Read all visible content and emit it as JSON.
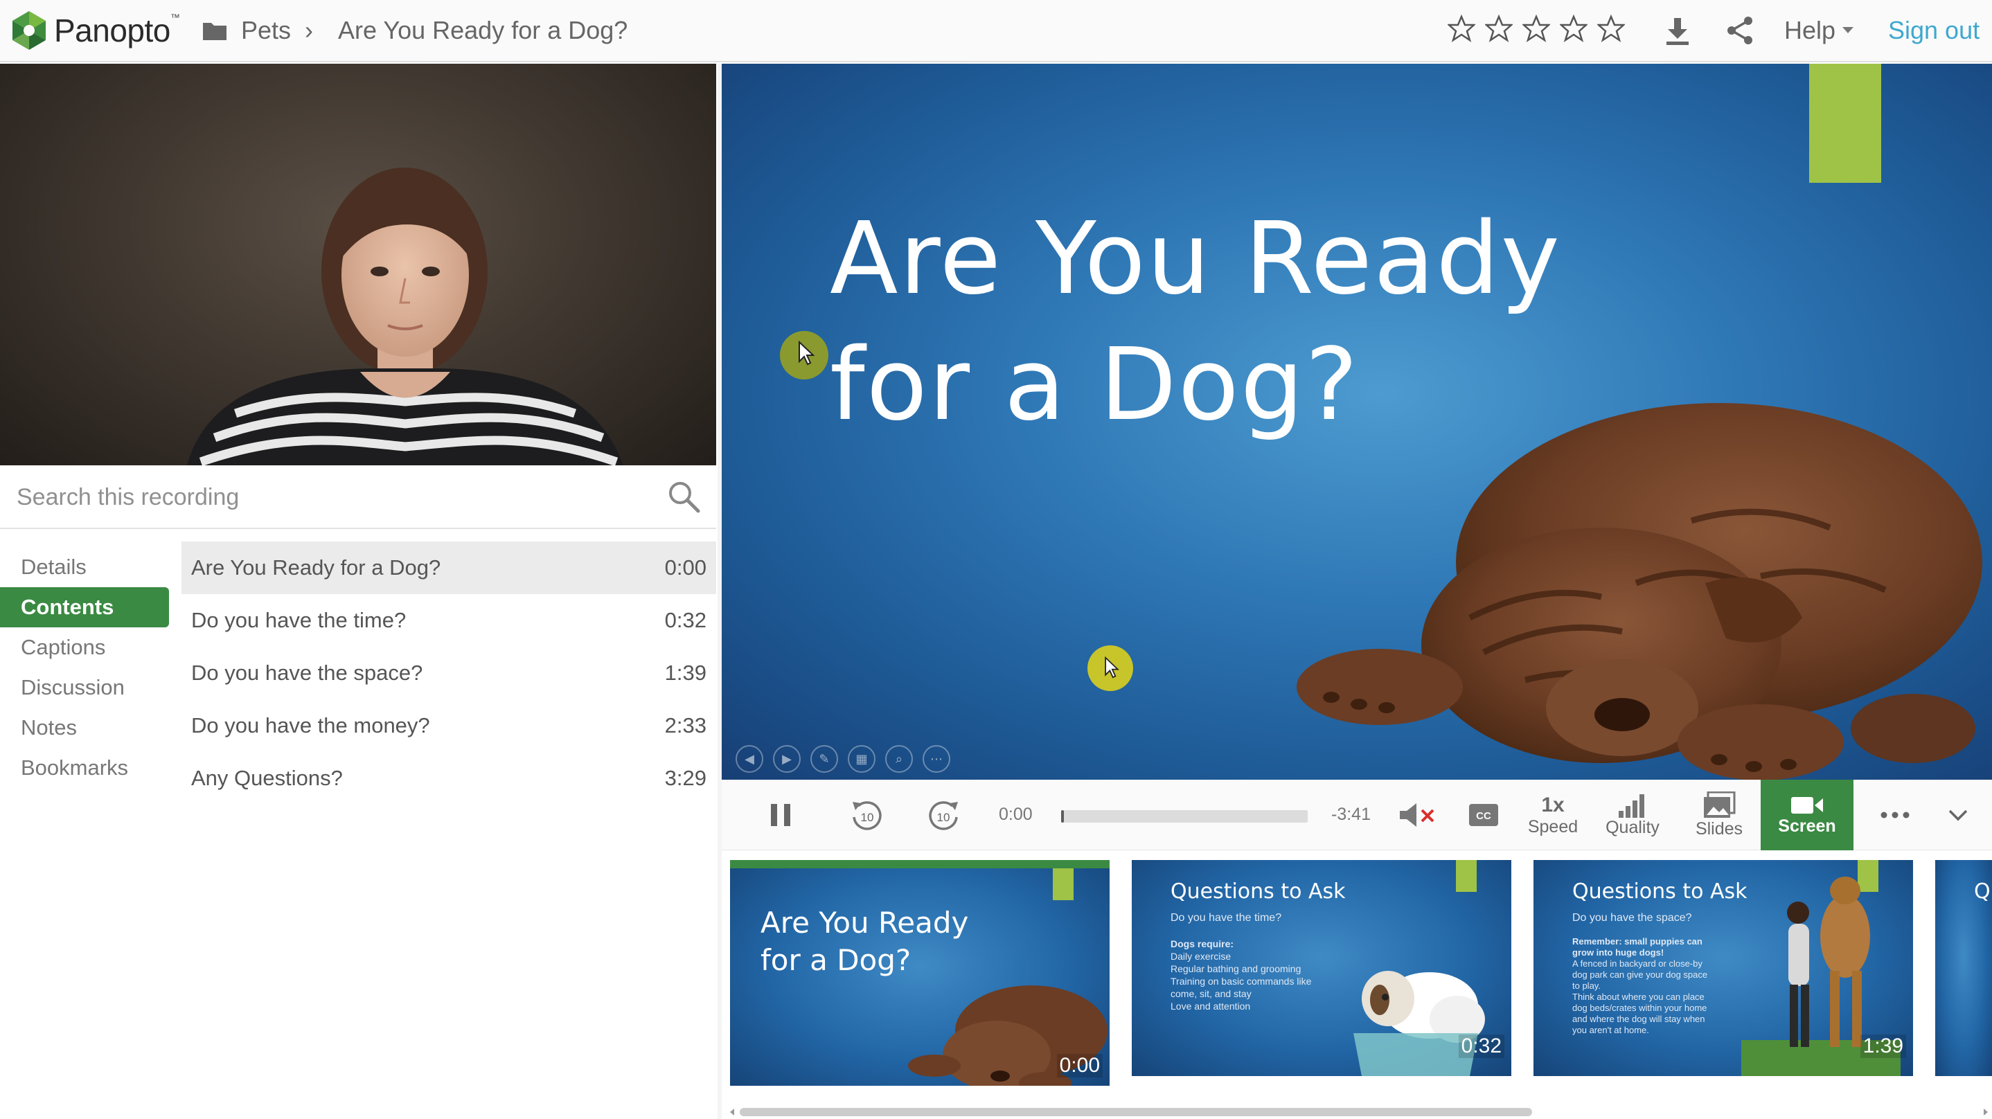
{
  "header": {
    "brand": "Panopto",
    "brand_tm": "™",
    "breadcrumb_folder": "Pets",
    "breadcrumb_separator": "›",
    "breadcrumb_title": "Are You Ready for a Dog?",
    "rating_stars": 5,
    "help_label": "Help",
    "signout_label": "Sign out"
  },
  "search": {
    "placeholder": "Search this recording"
  },
  "tabs": [
    {
      "label": "Details",
      "active": false
    },
    {
      "label": "Contents",
      "active": true
    },
    {
      "label": "Captions",
      "active": false
    },
    {
      "label": "Discussion",
      "active": false
    },
    {
      "label": "Notes",
      "active": false
    },
    {
      "label": "Bookmarks",
      "active": false
    }
  ],
  "contents": [
    {
      "title": "Are You Ready for a Dog?",
      "time": "0:00"
    },
    {
      "title": "Do you have the time?",
      "time": "0:32"
    },
    {
      "title": "Do you have the space?",
      "time": "1:39"
    },
    {
      "title": "Do you have the money?",
      "time": "2:33"
    },
    {
      "title": "Any Questions?",
      "time": "3:29"
    }
  ],
  "slide": {
    "title_line1": "Are You Ready",
    "title_line2": "for a Dog?"
  },
  "controls": {
    "elapsed": "0:00",
    "remaining": "-3:41",
    "progress_fraction": 0.01,
    "speed_value": "1x",
    "speed_label": "Speed",
    "quality_label": "Quality",
    "slides_label": "Slides",
    "screen_label": "Screen",
    "rewind_seconds": "10",
    "forward_seconds": "10"
  },
  "thumbnails": [
    {
      "title_line1": "Are You Ready",
      "title_line2": "for a Dog?",
      "time": "0:00"
    },
    {
      "title": "Questions to Ask",
      "subtitle": "Do you have the time?",
      "body": [
        "Dogs require:",
        "Daily exercise",
        "Regular bathing and grooming",
        "Training on basic commands like",
        "come, sit, and stay",
        "Love and attention"
      ],
      "time": "0:32"
    },
    {
      "title": "Questions to Ask",
      "subtitle": "Do you have the space?",
      "body": [
        "Remember: small puppies can",
        "grow into huge dogs!",
        "A fenced in backyard or close-by",
        "dog park can give your dog space",
        "to play.",
        "Think about where you can place",
        "dog beds/crates within your home",
        "and where the dog will stay when",
        "you aren't at home."
      ],
      "time": "1:39"
    },
    {
      "title": "Q",
      "time": ""
    }
  ],
  "colors": {
    "accent_green": "#3b8a43",
    "link_blue": "#3ea8cf",
    "slide_tab_green": "#9fc346"
  }
}
